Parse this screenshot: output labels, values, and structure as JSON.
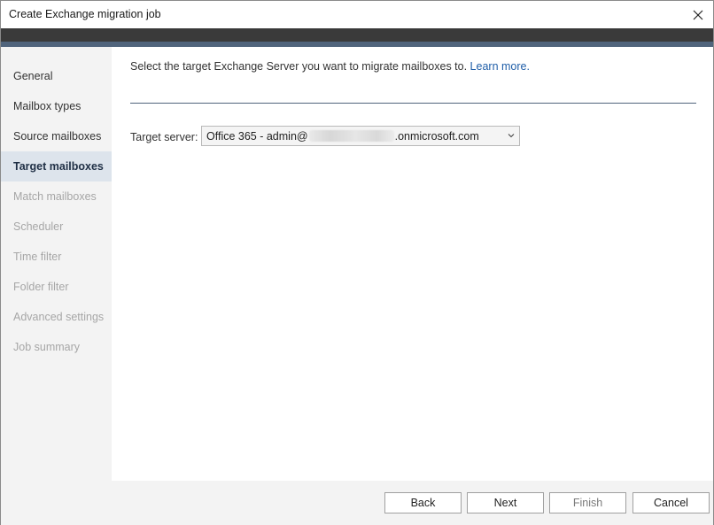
{
  "window": {
    "title": "Create Exchange migration job"
  },
  "sidebar": {
    "items": [
      {
        "label": "General",
        "state": "enabled"
      },
      {
        "label": "Mailbox types",
        "state": "enabled"
      },
      {
        "label": "Source mailboxes",
        "state": "enabled"
      },
      {
        "label": "Target mailboxes",
        "state": "active"
      },
      {
        "label": "Match mailboxes",
        "state": "disabled"
      },
      {
        "label": "Scheduler",
        "state": "disabled"
      },
      {
        "label": "Time filter",
        "state": "disabled"
      },
      {
        "label": "Folder filter",
        "state": "disabled"
      },
      {
        "label": "Advanced settings",
        "state": "disabled"
      },
      {
        "label": "Job summary",
        "state": "disabled"
      }
    ]
  },
  "main": {
    "instruction": "Select the target Exchange Server you want to migrate mailboxes to.",
    "learn_more": "Learn more.",
    "target_server": {
      "label": "Target server:",
      "value_prefix": "Office 365 - admin@",
      "value_suffix": ".onmicrosoft.com"
    }
  },
  "footer": {
    "back": "Back",
    "next": "Next",
    "finish": "Finish",
    "cancel": "Cancel"
  },
  "colors": {
    "dark_band": "#3a3a3a",
    "accent_band": "#50647c",
    "sidebar_bg": "#f3f3f3",
    "sidebar_active_bg": "#dde4ec",
    "link": "#1f5ea8"
  },
  "icons": {
    "close": "close-icon",
    "dropdown": "chevron-down-icon"
  }
}
